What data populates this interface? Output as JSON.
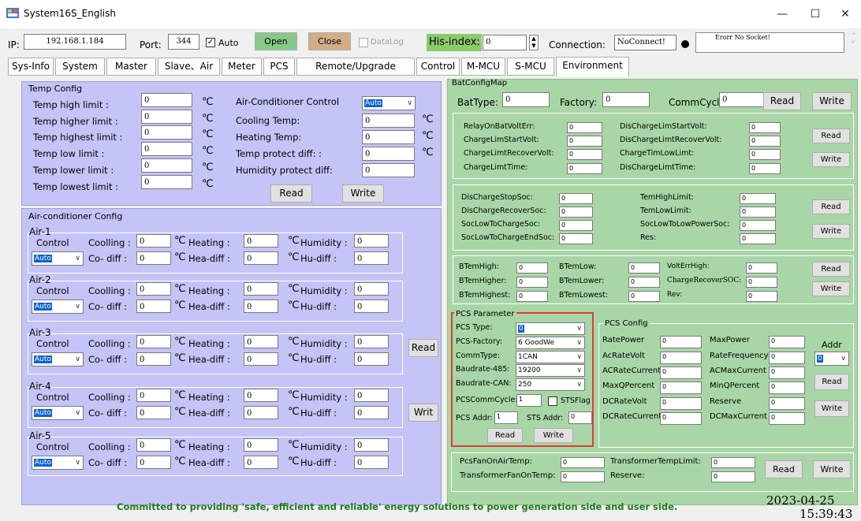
{
  "window": {
    "title": "System16S_English",
    "minimize": "—",
    "maximize": "☐",
    "close": "✕"
  },
  "conn": {
    "ip_label": "IP:",
    "ip": "192.168.1.184",
    "port_label": "Port:",
    "port": "344",
    "auto_label": "Auto",
    "open": "Open",
    "close": "Close",
    "datalog": "DataLog",
    "hisindex_label": "His-index:",
    "hisindex": "0",
    "connection_label": "Connection:",
    "connection": "NoConnect!",
    "error": "Erorr No Socket!"
  },
  "tabs": [
    "Sys-Info",
    "System",
    "Master",
    "Slave、Air",
    "Meter",
    "PCS",
    "Remote/Upgrade",
    "Control",
    "M-MCU",
    "S-MCU",
    "Environment"
  ],
  "temp": {
    "title": "Temp Config",
    "rows": [
      {
        "label": "Temp high limit :",
        "value": "0"
      },
      {
        "label": "Temp higher limit :",
        "value": "0"
      },
      {
        "label": "Temp highest limit :",
        "value": "0"
      },
      {
        "label": "Temp low limit :",
        "value": "0"
      },
      {
        "label": "Temp lower limit :",
        "value": "0"
      },
      {
        "label": "Temp lowest limit :",
        "value": "0"
      }
    ],
    "unit": "℃",
    "ac_label": "Air-Conditioner Control",
    "ac_value": "Auto",
    "right": [
      {
        "label": "Cooling Temp:",
        "value": "0"
      },
      {
        "label": "Heating Temp:",
        "value": "0"
      },
      {
        "label": "Temp protect diff: :",
        "value": "0"
      },
      {
        "label": "Humidity protect diff:",
        "value": "0"
      }
    ],
    "read": "Read",
    "write": "Write"
  },
  "air": {
    "title": "Air-conditioner Config",
    "control": "Control",
    "auto": "Auto",
    "cooling": "Coolling :",
    "heating": "Heating :",
    "humidity": "Humidity :",
    "codiff": "Co- diff :",
    "headiff": "Hea-diff :",
    "hudiff": "Hu-diff :",
    "zero": "0",
    "read": "Read",
    "write": "Writ",
    "units": [
      {
        "name": "Air-1"
      },
      {
        "name": "Air-2"
      },
      {
        "name": "Air-3"
      },
      {
        "name": "Air-4"
      },
      {
        "name": "Air-5"
      }
    ]
  },
  "bat": {
    "title": "BatConfigMap",
    "battype": "BatType:",
    "factory": "Factory:",
    "cycle": "CommCycle:",
    "zero": "0",
    "read": "Read",
    "write": "Write",
    "g1l": [
      "RelayOnBatVoltErr:",
      "ChargeLimStartVolt:",
      "ChargeLimtRecoverVolt:",
      "ChargeLimtTime:"
    ],
    "g1r": [
      "DisChargeLimStartVolt:",
      "DisChargeLimtRecoverVolt:",
      "ChargeTimLowLimt:",
      "DisChargeLimtTime:"
    ],
    "g2l": [
      "DisChargeStopSoc:",
      "DisChargeRecoverSoc:",
      "SocLowToChargeSoc:",
      "SocLowToChargeEndSoc:"
    ],
    "g2r": [
      "TemHighLimit:",
      "TemLowLimit:",
      "SocLowToLowPowerSoc:",
      "Res:"
    ],
    "g3a": [
      "BTemHigh:",
      "BTemHigher:",
      "BTemHighest:"
    ],
    "g3b": [
      "BTemLow:",
      "BTemLower:",
      "BTemLowest:"
    ],
    "g3c": [
      "VoltErrHigh:",
      "ChargeRecoverSOC:",
      "Rev:"
    ]
  },
  "pcs": {
    "title": "PCS Parameter",
    "type_label": "PCS Type:",
    "type": "0",
    "factory_label": "PCS-Factory:",
    "factory": "6 GoodWe",
    "comm_label": "CommType:",
    "comm": "1CAN",
    "b485_label": "Baudrate-485:",
    "b485": "19200",
    "bcan_label": "Baudrate-CAN:",
    "bcan": "250",
    "cycle_label": "PCSCommCycle:",
    "cycle": "1",
    "stsflag": "STSFlag",
    "addr_label": "PCS Addr:",
    "addr": "1",
    "sts_label": "STS Addr:",
    "sts": "0",
    "read": "Read",
    "write": "Write"
  },
  "pcscfg": {
    "title": "PCS Config",
    "l": [
      "RatePower",
      "AcRateVolt",
      "ACRateCurrent",
      "MaxQPercent",
      "DCRateVolt",
      "DCRateCurrent"
    ],
    "r": [
      "MaxPower",
      "RateFrequency",
      "ACMaxCurrent",
      "MinQPercent",
      "Reserve",
      "DCMaxCurrent"
    ],
    "zero": "0",
    "addr_label": "Addr",
    "addr": "0",
    "read": "Read",
    "write": "Write"
  },
  "fan": {
    "l": [
      "PcsFanOnAirTemp:",
      "TransformerFanOnTemp:"
    ],
    "r": [
      "TransformerTempLimit:",
      "Reserve:"
    ],
    "zero": "0",
    "read": "Read",
    "write": "Write"
  },
  "footer": {
    "slogan": "Committed to providing 'safe, efficient and reliable' energy solutions to power generation side and user side.",
    "date": "2023-04-25",
    "time": "15:39:43"
  }
}
